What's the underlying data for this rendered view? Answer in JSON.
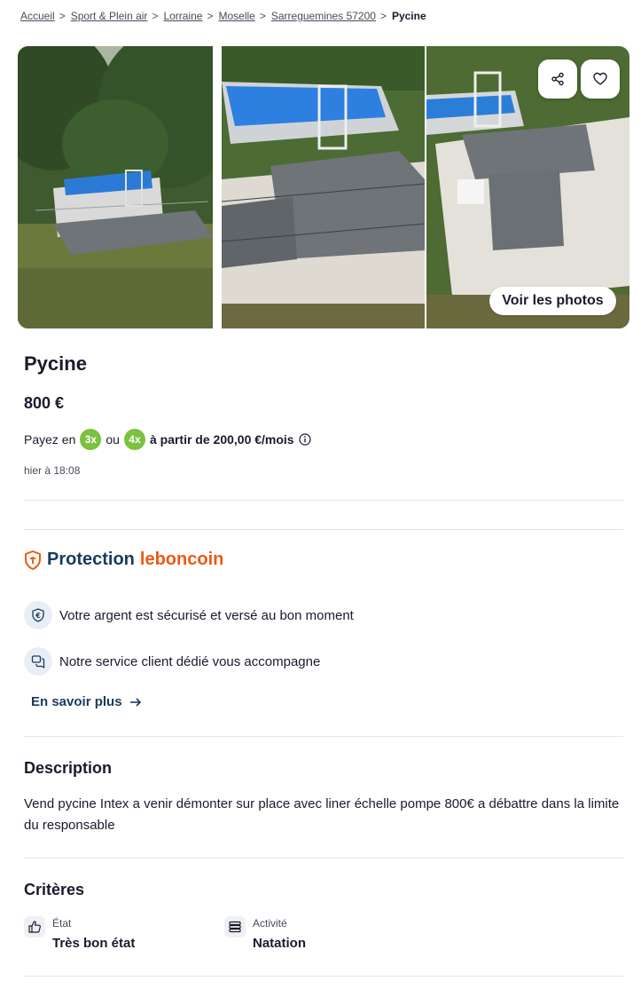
{
  "breadcrumb": {
    "items": [
      "Accueil",
      "Sport & Plein air",
      "Lorraine",
      "Moselle",
      "Sarreguemines 57200"
    ],
    "current": "Pycine",
    "separator": ">"
  },
  "gallery": {
    "photos_button": "Voir les photos",
    "share_icon": "share-icon",
    "favorite_icon": "heart-icon"
  },
  "listing": {
    "title": "Pycine",
    "price": "800 €",
    "payment": {
      "prefix": "Payez en",
      "option1": "3x",
      "or": "ou",
      "option2": "4x",
      "suffix": "à partir de 200,00 €/mois"
    },
    "date": "hier à 18:08"
  },
  "protection": {
    "label": "Protection",
    "brand": "leboncoin",
    "features": [
      {
        "icon": "euro-shield-icon",
        "text": "Votre argent est sécurisé et versé au bon moment"
      },
      {
        "icon": "chat-icon",
        "text": "Notre service client dédié vous accompagne"
      }
    ],
    "learn_more": "En savoir plus"
  },
  "description": {
    "title": "Description",
    "text": "Vend pycine Intex a venir démonter sur place avec liner échelle pompe 800€ a débattre dans la limite du responsable"
  },
  "criteria": {
    "title": "Critères",
    "items": [
      {
        "icon": "thumbs-up-icon",
        "label": "État",
        "value": "Très bon état"
      },
      {
        "icon": "list-icon",
        "label": "Activité",
        "value": "Natation"
      }
    ]
  },
  "colors": {
    "accent_orange": "#ec5a13",
    "navy": "#1b3a5c",
    "payment_green": "#7bc142"
  }
}
